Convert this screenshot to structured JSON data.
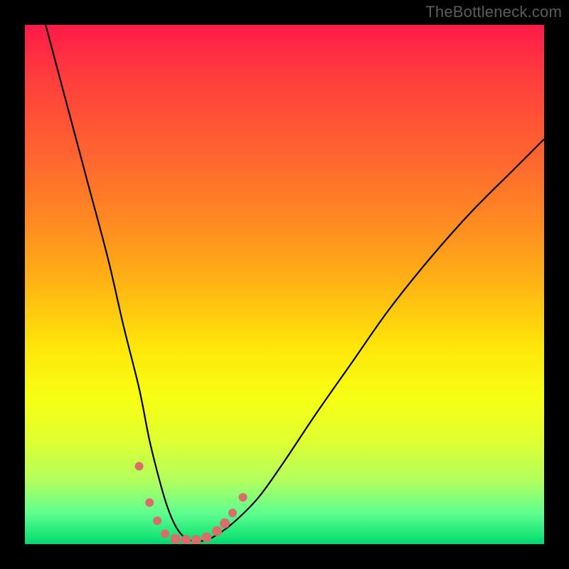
{
  "attribution": "TheBottleneck.com",
  "chart_data": {
    "type": "line",
    "title": "",
    "xlabel": "",
    "ylabel": "",
    "xlim": [
      0,
      100
    ],
    "ylim": [
      0,
      100
    ],
    "series": [
      {
        "name": "bottleneck-curve",
        "x": [
          4,
          8,
          12,
          16,
          19,
          22,
          24,
          26,
          27.5,
          29,
          30.5,
          32,
          34,
          36,
          40,
          45,
          50,
          56,
          63,
          70,
          78,
          86,
          94,
          100
        ],
        "values": [
          100,
          85,
          70,
          55,
          42,
          30,
          20,
          12,
          7,
          3.5,
          1.5,
          0.7,
          0.6,
          1.2,
          4,
          9,
          16,
          25,
          35,
          45,
          55,
          64,
          72,
          78
        ]
      }
    ],
    "markers": [
      {
        "x": 22.0,
        "y": 15.0,
        "r": 6
      },
      {
        "x": 24.0,
        "y": 8.0,
        "r": 6
      },
      {
        "x": 25.5,
        "y": 4.5,
        "r": 6
      },
      {
        "x": 27.0,
        "y": 2.0,
        "r": 6
      },
      {
        "x": 29.0,
        "y": 1.0,
        "r": 7
      },
      {
        "x": 31.0,
        "y": 0.8,
        "r": 7
      },
      {
        "x": 33.0,
        "y": 0.8,
        "r": 7
      },
      {
        "x": 35.0,
        "y": 1.3,
        "r": 7
      },
      {
        "x": 37.0,
        "y": 2.5,
        "r": 7
      },
      {
        "x": 38.5,
        "y": 4.0,
        "r": 7
      },
      {
        "x": 40.0,
        "y": 6.0,
        "r": 6
      },
      {
        "x": 42.0,
        "y": 9.0,
        "r": 6
      }
    ],
    "marker_color": "#d96d6a",
    "curve_color": "#000000"
  }
}
